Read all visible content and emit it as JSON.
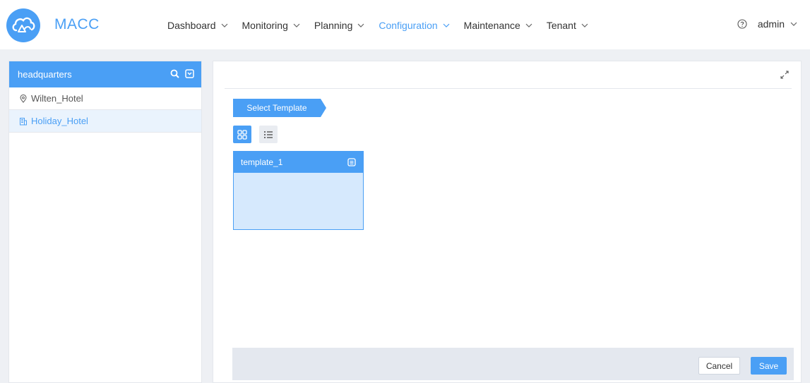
{
  "app": {
    "name": "MACC"
  },
  "nav": {
    "items": [
      {
        "label": "Dashboard",
        "active": false
      },
      {
        "label": "Monitoring",
        "active": false
      },
      {
        "label": "Planning",
        "active": false
      },
      {
        "label": "Configuration",
        "active": true
      },
      {
        "label": "Maintenance",
        "active": false
      },
      {
        "label": "Tenant",
        "active": false
      }
    ],
    "user": "admin",
    "help_icon": "help-circle-icon"
  },
  "sidebar": {
    "header": "headquarters",
    "header_icons": [
      "search-icon",
      "collapse-icon"
    ],
    "items": [
      {
        "label": "Wilten_Hotel",
        "icon": "location-pin-icon",
        "selected": false
      },
      {
        "label": "Holiday_Hotel",
        "icon": "building-icon",
        "selected": true
      }
    ]
  },
  "main": {
    "step_label": "Select Template",
    "view_modes": [
      "grid-view-icon",
      "list-view-icon"
    ],
    "templates": [
      {
        "name": "template_1",
        "icon": "details-icon"
      }
    ],
    "cancel_label": "Cancel",
    "save_label": "Save"
  },
  "colors": {
    "accent": "#4a9ff5",
    "card_fill": "#d6e9fd",
    "footer_bg": "#e4e8ef"
  }
}
